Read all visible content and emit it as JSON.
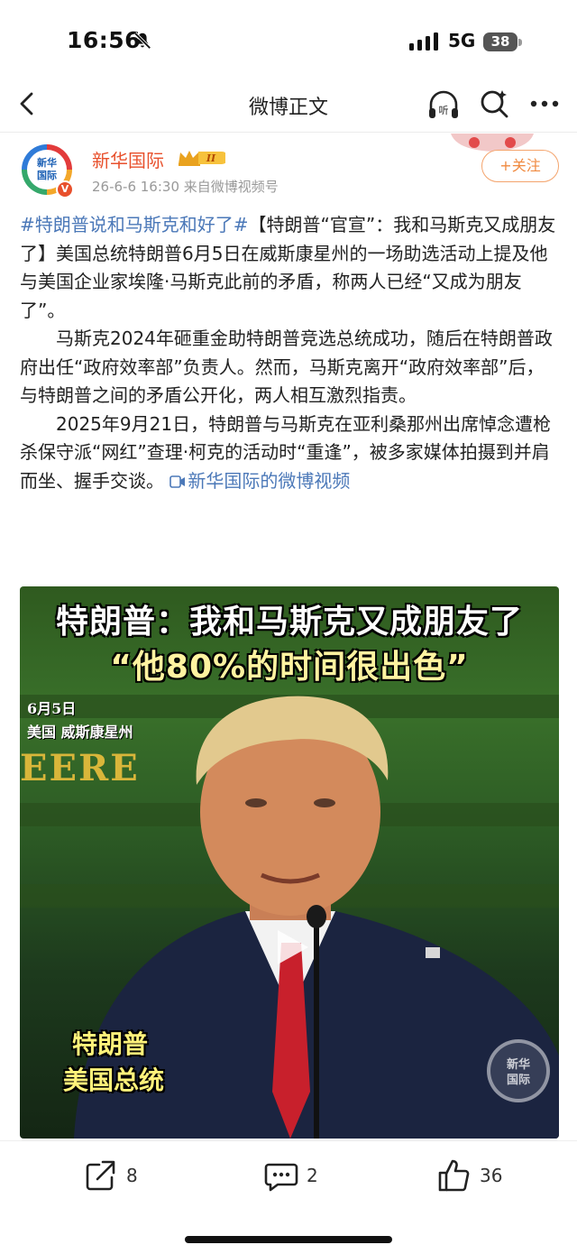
{
  "status_bar": {
    "time": "16:56",
    "network": "5G",
    "battery": "38"
  },
  "nav": {
    "title": "微博正文"
  },
  "post": {
    "author": "新华国际",
    "avatar_text_1": "新华",
    "avatar_text_2": "国际",
    "meta": "26-6-6 16:30  来自微博视频号",
    "follow_label": "+关注",
    "topic": "#特朗普说和马斯克和好了#",
    "para1_rest": "【特朗普“官宣”：我和马斯克又成朋友了】美国总统特朗普6月5日在威斯康星州的一场助选活动上提及他与美国企业家埃隆·马斯克此前的矛盾，称两人已经“又成为朋友了”。",
    "para2": "马斯克2024年砸重金助特朗普竞选总统成功，随后在特朗普政府出任“政府效率部”负责人。然而，马斯克离开“政府效率部”后，与特朗普之间的矛盾公开化，两人相互激烈指责。",
    "para3": "2025年9月21日，特朗普与马斯克在亚利桑那州出席悼念遭枪杀保守派“网红”查理·柯克的活动时“重逢”，被多家媒体拍摄到并肩而坐、握手交谈。",
    "video_link": "新华国际的微博视频"
  },
  "video": {
    "headline1": "特朗普：我和马斯克又成朋友了",
    "headline2": "“他80%的时间很出色”",
    "date": "6月5日",
    "place": "美国 威斯康星州",
    "caption_name": "特朗普",
    "caption_title": "美国总统",
    "background_sign": "EERE",
    "watermark_1": "新华",
    "watermark_2": "国际"
  },
  "actions": {
    "share_count": "8",
    "comment_count": "2",
    "like_count": "36"
  },
  "colors": {
    "accent": "#e8502c",
    "link": "#4b78b8",
    "follow": "#f08a40"
  }
}
